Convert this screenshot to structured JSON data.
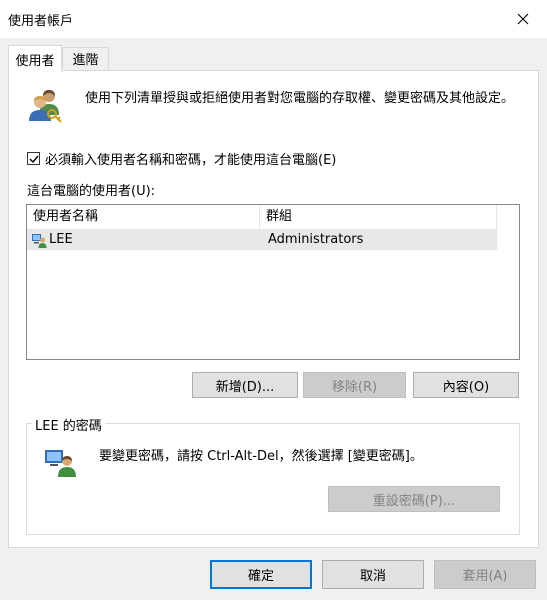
{
  "window": {
    "title": "使用者帳戶"
  },
  "tabs": [
    {
      "label": "使用者",
      "active": true
    },
    {
      "label": "進階",
      "active": false
    }
  ],
  "users_tab": {
    "intro": "使用下列清單授與或拒絕使用者對您電腦的存取權、變更密碼及其他設定。",
    "require_login_checkbox": {
      "label": "必須輸入使用者名稱和密碼，才能使用這台電腦(E)",
      "checked": true
    },
    "users_list_label": "這台電腦的使用者(U):",
    "columns": [
      "使用者名稱",
      "群組"
    ],
    "rows": [
      {
        "user": "LEE",
        "group": "Administrators",
        "selected": true
      }
    ],
    "buttons": {
      "add": "新增(D)...",
      "remove": "移除(R)",
      "properties": "內容(O)"
    },
    "password_group": {
      "title": "LEE 的密碼",
      "text": "要變更密碼，請按 Ctrl-Alt-Del，然後選擇 [變更密碼]。",
      "reset_button": "重設密碼(P)..."
    }
  },
  "footer": {
    "ok": "確定",
    "cancel": "取消",
    "apply": "套用(A)"
  },
  "icons": {
    "users": "users-icon",
    "user_row": "user-row-icon",
    "password": "password-user-icon",
    "close": "close-icon",
    "check": "checkmark-icon"
  }
}
